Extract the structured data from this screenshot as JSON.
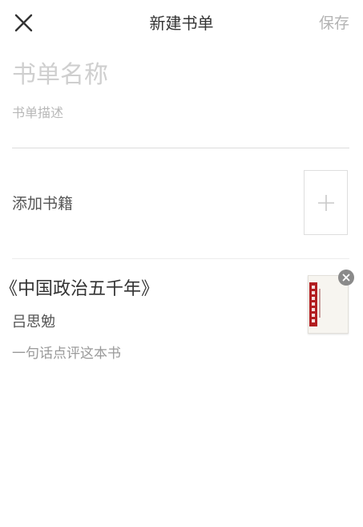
{
  "header": {
    "title": "新建书单",
    "save_label": "保存",
    "close_icon": "close-icon"
  },
  "form": {
    "name_placeholder": "书单名称",
    "name_value": "",
    "description_placeholder": "书单描述",
    "description_value": ""
  },
  "add_books": {
    "label": "添加书籍",
    "icon": "plus-icon"
  },
  "books": [
    {
      "title": "《中国政治五千年》",
      "author": "吕思勉",
      "comment_placeholder": "一句话点评这本书",
      "comment_value": "",
      "cover_color": "#b21d21",
      "remove_icon": "remove-icon"
    }
  ],
  "colors": {
    "text_primary": "#333333",
    "placeholder": "#cfcfcf",
    "save_disabled": "#b3b3b3",
    "divider": "#dcdcdc",
    "remove_badge": "#8a8a8a"
  }
}
